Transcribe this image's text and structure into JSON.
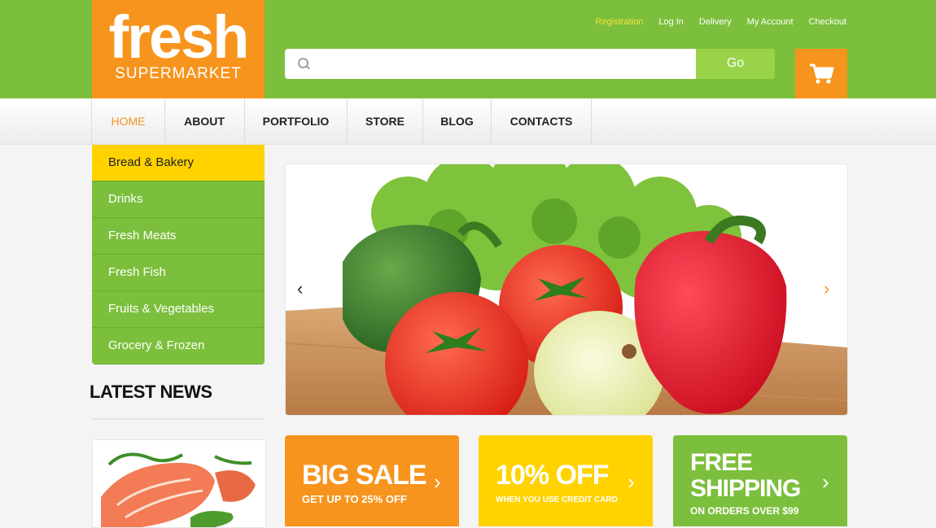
{
  "brand": {
    "name": "fresh",
    "tagline": "SUPERMARKET"
  },
  "top_links": [
    "Registration",
    "Log In",
    "Delivery",
    "My Account",
    "Checkout"
  ],
  "search": {
    "placeholder": "",
    "button_label": "Go"
  },
  "nav": [
    "HOME",
    "ABOUT",
    "PORTFOLIO",
    "STORE",
    "BLOG",
    "CONTACTS"
  ],
  "categories": [
    "Bread & Bakery",
    "Drinks",
    "Fresh Meats",
    "Fresh Fish",
    "Fruits & Vegetables",
    "Grocery & Frozen"
  ],
  "sidebar": {
    "latest_news_title": "LATEST NEWS"
  },
  "slider": {
    "prev_label": "‹",
    "next_label": "›"
  },
  "promos": [
    {
      "title": "BIG SALE",
      "subtitle": "GET UP TO 25% OFF",
      "chevron": "›"
    },
    {
      "title": "10% OFF",
      "subtitle": "WHEN YOU USE CREDIT CARD",
      "chevron": "›"
    },
    {
      "title_line1": "FREE",
      "title_line2": "SHIPPING",
      "subtitle": "ON ORDERS OVER $99",
      "chevron": "›"
    }
  ],
  "colors": {
    "green": "#7cbf3c",
    "orange": "#f7941d",
    "yellow": "#ffd200"
  },
  "icons": [
    "search-icon",
    "cart-icon",
    "chevron-left-icon",
    "chevron-right-icon"
  ]
}
